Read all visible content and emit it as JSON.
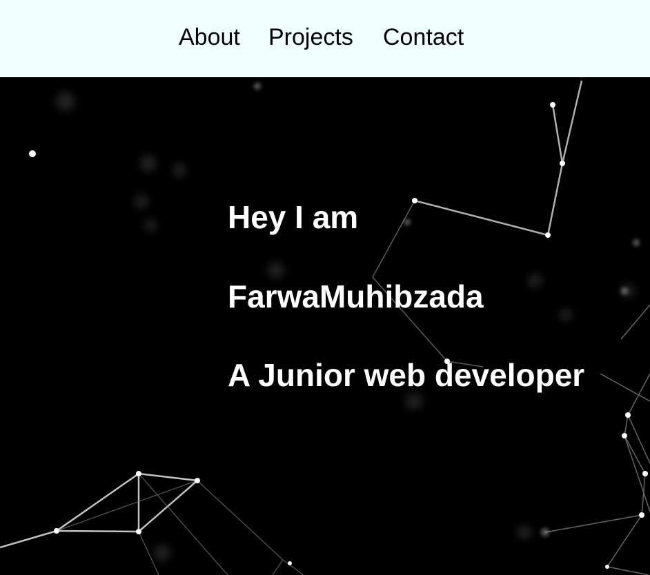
{
  "nav": {
    "links": [
      "About",
      "Projects",
      "Contact"
    ]
  },
  "hero": {
    "lines": [
      "Hey I am",
      "FarwaMuhibzada",
      "A Junior web developer"
    ]
  },
  "colors": {
    "navbar_bg": "#f0ffff",
    "hero_bg": "#000000",
    "hero_text": "#ffffff"
  }
}
